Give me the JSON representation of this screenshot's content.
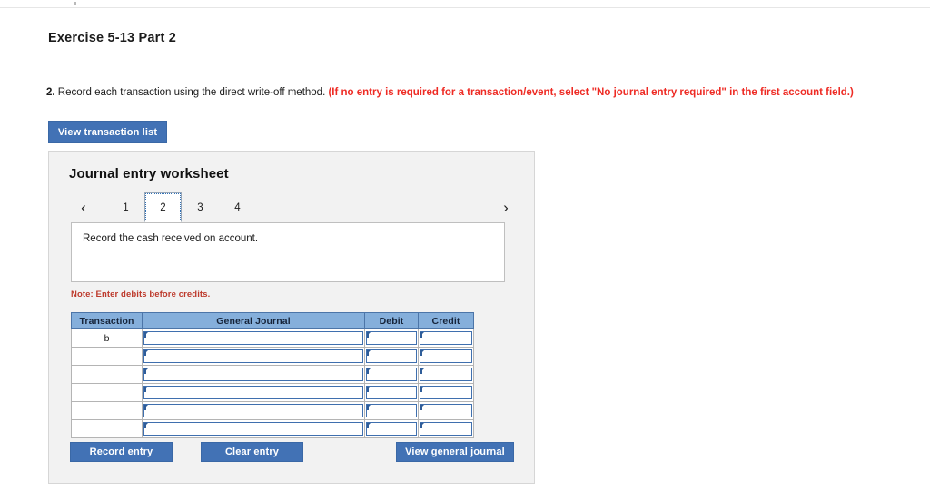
{
  "page": {
    "title": "Exercise 5-13 Part 2"
  },
  "instruction": {
    "number": "2.",
    "text": "Record each transaction using the direct write-off method.",
    "requirement": "(If no entry is required for a transaction/event, select \"No journal entry required\" in the first account field.)"
  },
  "toolbar": {
    "view_transaction_list_label": "View transaction list"
  },
  "worksheet": {
    "title": "Journal entry worksheet",
    "pager": {
      "prev_icon": "chevron-left-icon",
      "next_icon": "chevron-right-icon",
      "tabs": [
        "1",
        "2",
        "3",
        "4"
      ],
      "active_tab": "2"
    },
    "description": "Record the cash received on account.",
    "note": "Note: Enter debits before credits.",
    "table": {
      "headers": [
        "Transaction",
        "General Journal",
        "Debit",
        "Credit"
      ],
      "rows": [
        {
          "transaction": "b",
          "general_journal": "",
          "debit": "",
          "credit": ""
        },
        {
          "transaction": "",
          "general_journal": "",
          "debit": "",
          "credit": ""
        },
        {
          "transaction": "",
          "general_journal": "",
          "debit": "",
          "credit": ""
        },
        {
          "transaction": "",
          "general_journal": "",
          "debit": "",
          "credit": ""
        },
        {
          "transaction": "",
          "general_journal": "",
          "debit": "",
          "credit": ""
        },
        {
          "transaction": "",
          "general_journal": "",
          "debit": "",
          "credit": ""
        }
      ]
    },
    "actions": {
      "record_entry_label": "Record entry",
      "clear_entry_label": "Clear entry",
      "view_general_journal_label": "View general journal"
    }
  },
  "colors": {
    "button_blue": "#4272b5",
    "table_header_blue": "#85afdb",
    "panel_background": "#f2f2f2",
    "alert_red": "#ee2b24",
    "note_red": "#bd3a2c",
    "input_border_blue": "#3f6fae"
  }
}
